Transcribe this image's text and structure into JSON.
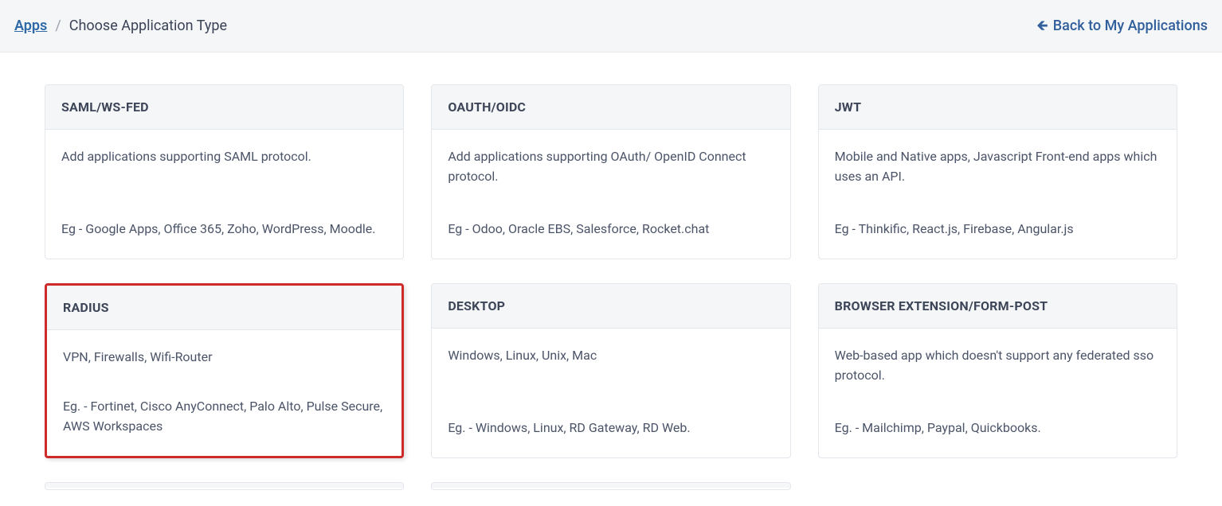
{
  "breadcrumb": {
    "root": "Apps",
    "separator": "/",
    "current": "Choose Application Type"
  },
  "back_link": {
    "label": "Back to My Applications"
  },
  "cards": [
    {
      "title": "SAML/WS-FED",
      "description": "Add applications supporting SAML protocol.",
      "example": "Eg - Google Apps, Office 365, Zoho, WordPress, Moodle.",
      "highlight": false
    },
    {
      "title": "OAUTH/OIDC",
      "description": "Add applications supporting OAuth/ OpenID Connect protocol.",
      "example": "Eg - Odoo, Oracle EBS, Salesforce, Rocket.chat",
      "highlight": false
    },
    {
      "title": "JWT",
      "description": "Mobile and Native apps, Javascript Front-end apps which uses an API.",
      "example": "Eg - Thinkific, React.js, Firebase, Angular.js",
      "highlight": false
    },
    {
      "title": "RADIUS",
      "description": "VPN, Firewalls, Wifi-Router",
      "example": "Eg. - Fortinet, Cisco AnyConnect, Palo Alto, Pulse Secure, AWS Workspaces",
      "highlight": true
    },
    {
      "title": "DESKTOP",
      "description": "Windows, Linux, Unix, Mac",
      "example": "Eg. - Windows, Linux, RD Gateway, RD Web.",
      "highlight": false
    },
    {
      "title": "BROWSER EXTENSION/FORM-POST",
      "description": "Web-based app which doesn't support any federated sso protocol.",
      "example": "Eg. - Mailchimp, Paypal, Quickbooks.",
      "highlight": false
    }
  ]
}
